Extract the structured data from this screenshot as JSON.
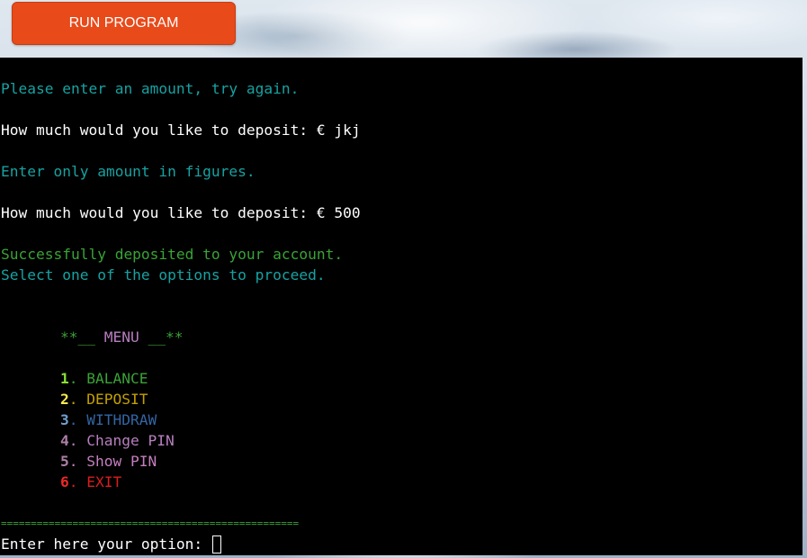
{
  "run_button": {
    "label": "RUN PROGRAM"
  },
  "terminal": {
    "messages": {
      "invalid_amount": "Please enter an amount, try again.",
      "deposit_prompt_1": "How much would you like to deposit: € jkj",
      "figures_only": "Enter only amount in figures.",
      "deposit_prompt_2": "How much would you like to deposit: € 500",
      "success": "Successfully deposited to your account.",
      "select_option": "Select one of the options to proceed."
    },
    "menu": {
      "title_stars_left": "**__",
      "title_text": " MENU ",
      "title_stars_right": "__**",
      "items": [
        {
          "number": "1",
          "label": "BALANCE",
          "color": "#3aa336",
          "number_color": "#8ae234"
        },
        {
          "number": "2",
          "label": "DEPOSIT",
          "color": "#c4a000",
          "number_color": "#fce94f"
        },
        {
          "number": "3",
          "label": "WITHDRAW",
          "color": "#3465a4",
          "number_color": "#729fcf"
        },
        {
          "number": "4",
          "label": "Change PIN",
          "color": "#b77fbf",
          "number_color": "#ad7fa8"
        },
        {
          "number": "5",
          "label": "Show PIN",
          "color": "#c57fc0",
          "number_color": "#ad7fa8"
        },
        {
          "number": "6",
          "label": "EXIT",
          "color": "#d81e1e",
          "number_color": "#ef2929"
        }
      ]
    },
    "separator": "==================================================",
    "input_prompt": "Enter here your option: "
  },
  "colors": {
    "background": "#000000",
    "info_text": "#17a2a2",
    "prompt_text": "#ffffff",
    "success_text": "#3aa336",
    "menu_title_stars": "#3aa336",
    "menu_title_text": "#b77fbf",
    "separator": "#3aa336",
    "run_button": "#e84a1a"
  }
}
